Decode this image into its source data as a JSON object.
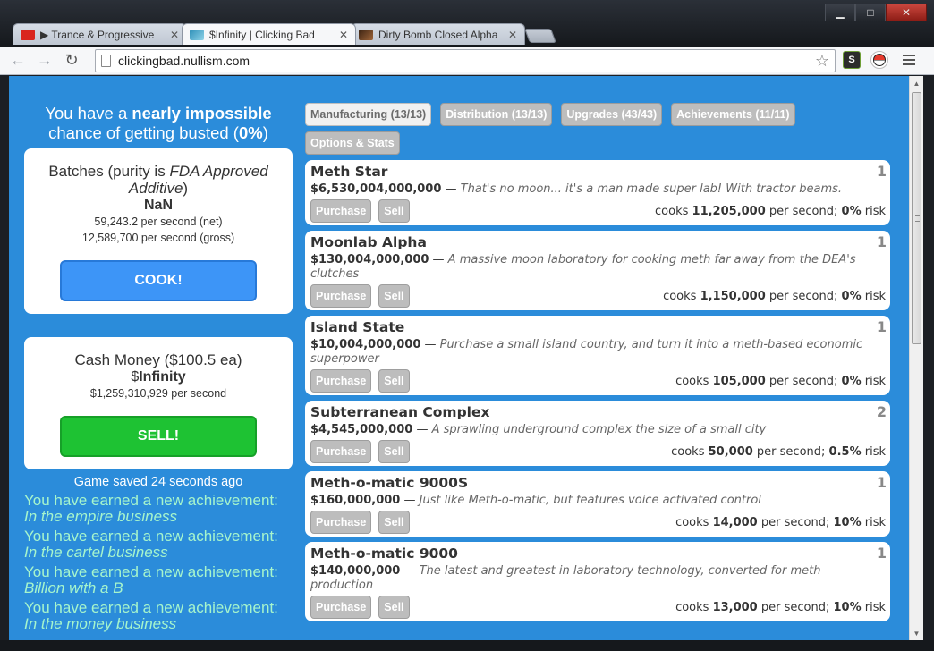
{
  "browser": {
    "tabs": [
      {
        "title": "▶ Trance & Progressive",
        "favicon_color": "#d9251d",
        "icon": "youtube-icon"
      },
      {
        "title": "$Infinity | Clicking Bad",
        "favicon_color": "#3aa0c8",
        "icon": "clickingbad-icon"
      },
      {
        "title": "Dirty Bomb Closed Alpha",
        "favicon_color": "#7b4a2a",
        "icon": "dirtybomb-icon"
      }
    ],
    "url": "clickingbad.nullism.com",
    "extension_label": "S",
    "minimize": "▁",
    "maximize": "□",
    "close": "✕"
  },
  "status": {
    "bust_prefix": "You have a ",
    "bust_bold": "nearly impossible",
    "bust_mid": "chance of getting busted (",
    "bust_pct": "0%",
    "bust_suffix": ")"
  },
  "batches": {
    "title_prefix": "Batches (purity is ",
    "purity": "FDA Approved Additive",
    "title_suffix": ")",
    "value": "NaN",
    "net": "59,243.2 per second (net)",
    "gross": "12,589,700 per second (gross)",
    "cook_label": "COOK!"
  },
  "cash": {
    "title": "Cash Money ($100.5 ea)",
    "value_prefix": "$",
    "value": "Infinity",
    "rate": "$1,259,310,929 per second",
    "sell_label": "SELL!"
  },
  "saved": "Game saved 24 seconds ago",
  "achievements": [
    {
      "prefix": "You have earned a new achievement: ",
      "name": "In the empire business"
    },
    {
      "prefix": "You have earned a new achievement: ",
      "name": "In the cartel business"
    },
    {
      "prefix": "You have earned a new achievement: ",
      "name": "Billion with a B"
    },
    {
      "prefix": "You have earned a new achievement: ",
      "name": "In the money business"
    }
  ],
  "game_tabs": [
    {
      "label": "Manufacturing (13/13)",
      "active": true
    },
    {
      "label": "Distribution (13/13)",
      "active": false
    },
    {
      "label": "Upgrades (43/43)",
      "active": false
    },
    {
      "label": "Achievements (11/11)",
      "active": false
    },
    {
      "label": "Options & Stats",
      "active": false
    }
  ],
  "item_labels": {
    "purchase": "Purchase",
    "sell": "Sell",
    "dash": " — ",
    "cooks": "cooks ",
    "per_second": " per second; ",
    "risk": " risk"
  },
  "items": [
    {
      "name": "Meth Star",
      "count": "1",
      "price": "$6,530,004,000,000",
      "desc": "That's no moon... it's a man made super lab! With tractor beams.",
      "rate": "11,205,000",
      "risk": "0%"
    },
    {
      "name": "Moonlab Alpha",
      "count": "1",
      "price": "$130,004,000,000",
      "desc": "A massive moon laboratory for cooking meth far away from the DEA's clutches",
      "rate": "1,150,000",
      "risk": "0%"
    },
    {
      "name": "Island State",
      "count": "1",
      "price": "$10,004,000,000",
      "desc": "Purchase a small island country, and turn it into a meth-based economic superpower",
      "rate": "105,000",
      "risk": "0%"
    },
    {
      "name": "Subterranean Complex",
      "count": "2",
      "price": "$4,545,000,000",
      "desc": "A sprawling underground complex the size of a small city",
      "rate": "50,000",
      "risk": "0.5%"
    },
    {
      "name": "Meth-o-matic 9000S",
      "count": "1",
      "price": "$160,000,000",
      "desc": "Just like Meth-o-matic, but features voice activated control",
      "rate": "14,000",
      "risk": "10%"
    },
    {
      "name": "Meth-o-matic 9000",
      "count": "1",
      "price": "$140,000,000",
      "desc": "The latest and greatest in laboratory technology, converted for meth production",
      "rate": "13,000",
      "risk": "10%"
    }
  ]
}
